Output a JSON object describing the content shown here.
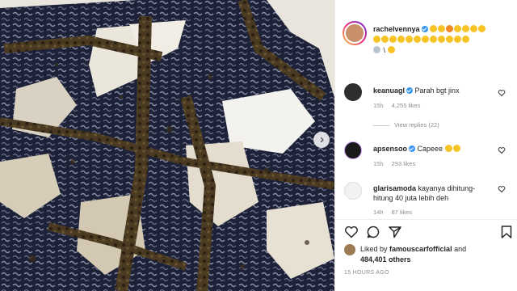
{
  "post": {
    "author": "rachelvennya",
    "caption_suffix": "\\ "
  },
  "comments": [
    {
      "username": "keanuagl",
      "text": "Parah bgt jinx",
      "time": "15h",
      "likes": "4,255 likes",
      "verified": true
    },
    {
      "username": "apsensoo",
      "text": "Capeee",
      "time": "15h",
      "likes": "293 likes",
      "verified": true
    },
    {
      "username": "glarisamoda",
      "text": "kayanya dihitung-hitung 40 juta lebih deh",
      "time": "14h",
      "likes": "87 likes",
      "verified": false
    }
  ],
  "view_replies": "View replies (22)",
  "likes_summary": {
    "prefix": "Liked by",
    "user": "famouscarfofficial",
    "joiner": "and",
    "count": "484,401 others"
  },
  "timestamp": "15 HOURS AGO",
  "colors": {
    "verified": "#3897f0",
    "muted": "#8e8e8e",
    "text": "#262626"
  },
  "icons": [
    "heart-icon",
    "comment-icon",
    "share-icon",
    "bookmark-icon",
    "chevron-right-icon"
  ]
}
